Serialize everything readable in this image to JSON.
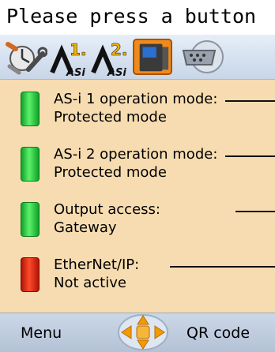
{
  "title": "Please press a button",
  "toolbar": {
    "icons": [
      {
        "name": "settings-tools-icon"
      },
      {
        "name": "asi-1-icon",
        "label": "1.",
        "sub": "ASi"
      },
      {
        "name": "asi-2-icon",
        "label": "2.",
        "sub": "ASi"
      },
      {
        "name": "gateway-device-icon"
      },
      {
        "name": "serial-port-icon"
      }
    ]
  },
  "status_rows": [
    {
      "name": "asi1-operation-mode",
      "line1": "AS-i 1 operation mode:",
      "line2": "Protected mode",
      "led": "green"
    },
    {
      "name": "asi2-operation-mode",
      "line1": "AS-i 2 operation mode:",
      "line2": "Protected mode",
      "led": "green"
    },
    {
      "name": "output-access",
      "line1": "Output access:",
      "line2": "Gateway",
      "led": "green"
    },
    {
      "name": "ethernet-ip",
      "line1": "EtherNet/IP:",
      "line2": "Not active",
      "led": "red"
    }
  ],
  "footer": {
    "menu_label": "Menu",
    "qr_label": "QR code"
  },
  "colors": {
    "background": "#f6dcb0",
    "led_green": "#2ecc40",
    "led_red": "#e0301e",
    "dpad_orange": "#f39a00"
  }
}
